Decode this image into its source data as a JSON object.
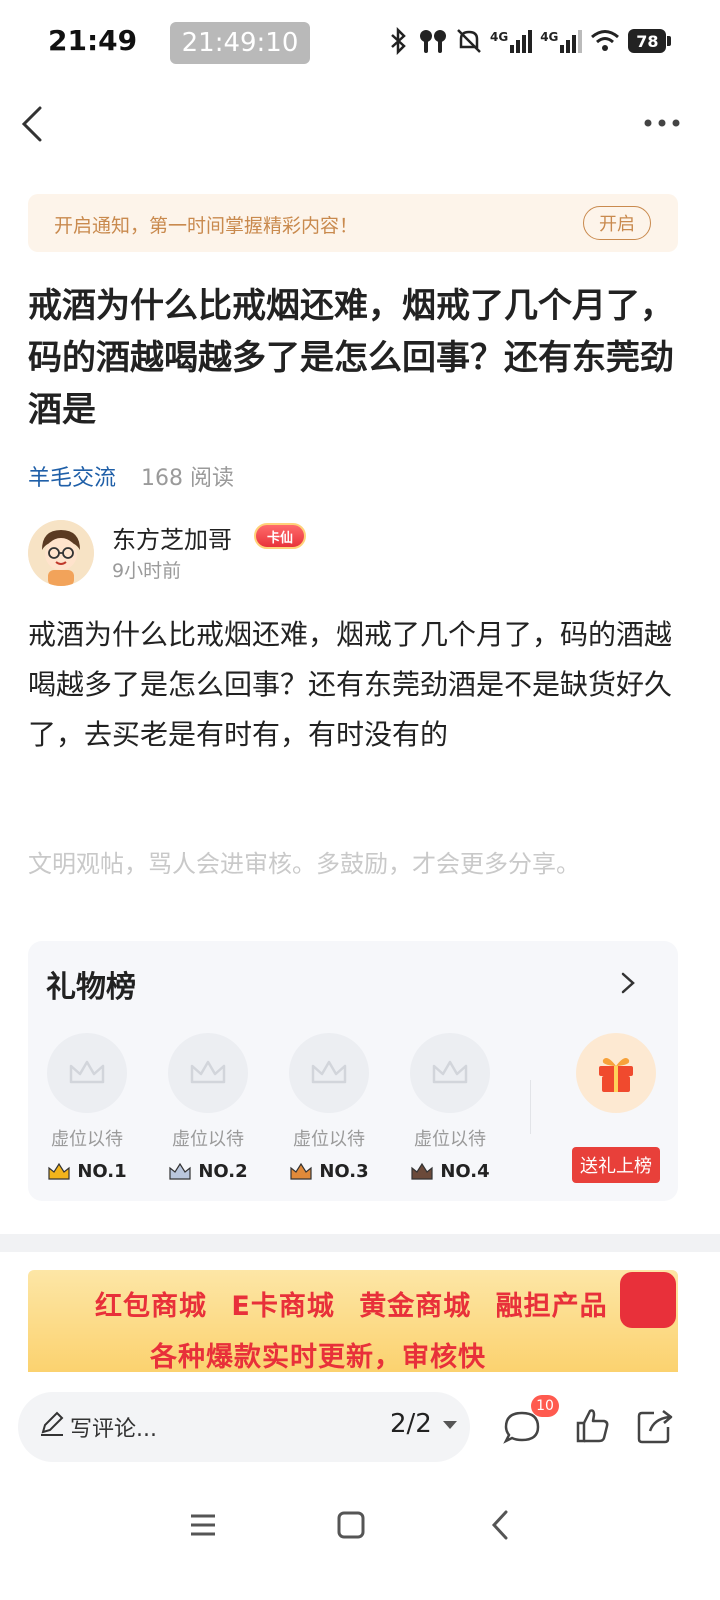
{
  "status_bar": {
    "time": "21:49",
    "clock_overlay": "21:49:10",
    "battery": "78",
    "network_labels": [
      "4G",
      "4G"
    ]
  },
  "notice": {
    "text": "开启通知，第一时间掌握精彩内容！",
    "button": "开启"
  },
  "post": {
    "title": "戒酒为什么比戒烟还难，烟戒了几个月了，码的酒越喝越多了是怎么回事？还有东莞劲酒是",
    "category": "羊毛交流",
    "reads": "168 阅读",
    "author": "东方芝加哥",
    "author_badge": "卡仙",
    "time": "9小时前",
    "body": "戒酒为什么比戒烟还难，烟戒了几个月了，码的酒越喝越多了是怎么回事？还有东莞劲酒是不是缺货好久了，去买老是有时有，有时没有的",
    "hint": "文明观帖，骂人会进审核。多鼓励，才会更多分享。"
  },
  "gifts": {
    "title": "礼物榜",
    "slots": [
      {
        "label": "虚位以待",
        "rank": "NO.1",
        "crown_color": "#f2b41b"
      },
      {
        "label": "虚位以待",
        "rank": "NO.2",
        "crown_color": "#7f93b5"
      },
      {
        "label": "虚位以待",
        "rank": "NO.3",
        "crown_color": "#e08a3a"
      },
      {
        "label": "虚位以待",
        "rank": "NO.4",
        "crown_color": "#6b4a3a"
      }
    ],
    "send_button": "送礼上榜"
  },
  "banner": {
    "line1": "红包商城 E卡商城 黄金商城 融担产品",
    "line2": "各种爆款实时更新，审核快"
  },
  "bottom_bar": {
    "comment_placeholder": "写评论...",
    "pager": "2/2",
    "comments_count": "10"
  },
  "colors": {
    "accent_blue": "#1f5fa8",
    "notice_text": "#c98a4e",
    "send_button": "#e8403a",
    "badge_red": "#ff5a4f"
  }
}
